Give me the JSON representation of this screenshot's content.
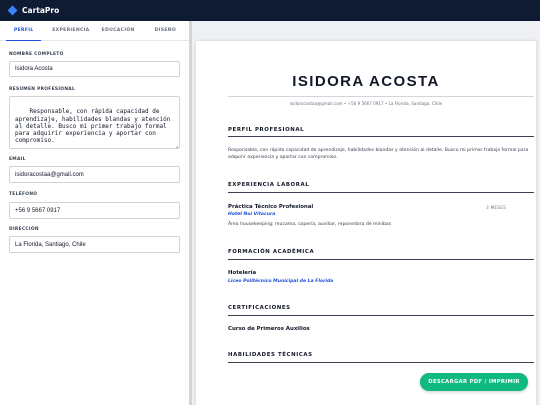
{
  "app": {
    "brand": "CartaPro",
    "accent": "#3b82f6"
  },
  "tabs": [
    {
      "label": "PERFIL",
      "active": true
    },
    {
      "label": "EXPERIENCIA",
      "active": false
    },
    {
      "label": "EDUCACIÓN",
      "active": false
    },
    {
      "label": "DISEÑO",
      "active": false
    }
  ],
  "form": {
    "name_label": "NOMBRE COMPLETO",
    "name_value": "Isidora Acosta",
    "summary_label": "RESUMEN PROFESIONAL",
    "summary_value": "Responsable, con rápida capacidad de\naprendizaje, habilidades blandas y atención\nal detalle. Busco mi primer trabajo formal\npara adquirir experiencia y aportar con\ncompromiso.",
    "email_label": "EMAIL",
    "email_value": "isidoracostaa@gmail.com",
    "phone_label": "TELÉFONO",
    "phone_value": "+56 9 5667 0917",
    "address_label": "DIRECCIÓN",
    "address_value": "La Florida, Santiago, Chile"
  },
  "document": {
    "name": "ISIDORA ACOSTA",
    "contact": "isidoracostaa@gmail.com • +56 9 5667 0917 • La Florida, Santiago, Chile",
    "profile_title": "PERFIL PROFESIONAL",
    "profile_text": "Responsable, con rápida capacidad de aprendizaje, habilidades blandas y atención al detalle. Busco mi primer trabajo formal para adquirir experiencia y aportar con compromiso.",
    "experience_title": "EXPERIENCIA LABORAL",
    "experience": {
      "role": "Práctica Técnico Profesional",
      "company": "Hotel Noi Vitacura",
      "duration": "3 MESES",
      "description": "Área housekeeping: mucama, copería, auxiliar, reponedora de minibas"
    },
    "education_title": "FORMACIÓN ACADÉMICA",
    "education": {
      "program": "Hotelería",
      "institution": "Liceo Politécnico Municipal de La Florida"
    },
    "certifications_title": "CERTIFICACIONES",
    "certification": "Curso de Primeros Auxilios",
    "skills_title": "HABILIDADES TÉCNICAS"
  },
  "actions": {
    "download_label": "DESCARGAR PDF / IMPRIMIR"
  }
}
